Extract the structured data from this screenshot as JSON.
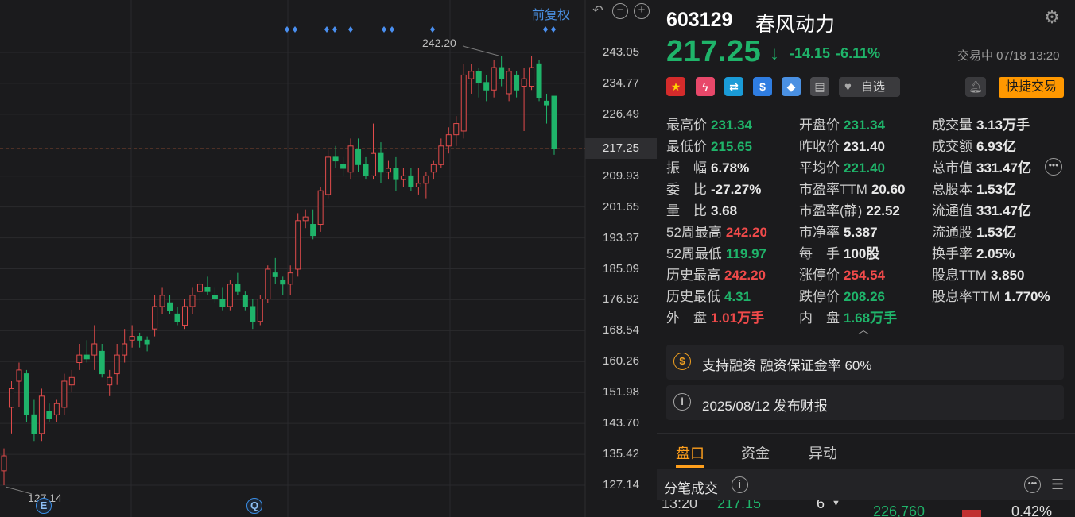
{
  "chart": {
    "adj_label": "前复权",
    "icons": [
      "undo-icon",
      "zoom-out-icon",
      "zoom-in-icon"
    ],
    "price_axis": [
      "243.05",
      "234.77",
      "226.49",
      "217.25",
      "209.93",
      "201.65",
      "193.37",
      "185.09",
      "176.82",
      "168.54",
      "160.26",
      "151.98",
      "143.70",
      "135.42",
      "127.14"
    ],
    "current_price_tag": "217.25",
    "high_label": "242.20",
    "low_label": "127.14",
    "event_badges": [
      "E",
      "Q"
    ]
  },
  "chart_data": {
    "type": "candlestick",
    "ylim": [
      127.14,
      243.05
    ],
    "current_price": 217.25,
    "period_high": 242.2,
    "period_low": 127.14,
    "candles": [
      {
        "o": 131,
        "h": 137,
        "l": 127.14,
        "c": 135
      },
      {
        "o": 148,
        "h": 155,
        "l": 141,
        "c": 153
      },
      {
        "o": 155,
        "h": 160,
        "l": 148,
        "c": 158
      },
      {
        "o": 157,
        "h": 158,
        "l": 144,
        "c": 146
      },
      {
        "o": 146,
        "h": 150,
        "l": 139,
        "c": 141
      },
      {
        "o": 141,
        "h": 153,
        "l": 139,
        "c": 151
      },
      {
        "o": 147,
        "h": 149,
        "l": 144,
        "c": 145
      },
      {
        "o": 146,
        "h": 150,
        "l": 144,
        "c": 149
      },
      {
        "o": 148,
        "h": 157,
        "l": 146,
        "c": 155
      },
      {
        "o": 154,
        "h": 158,
        "l": 152,
        "c": 156
      },
      {
        "o": 160,
        "h": 165,
        "l": 158,
        "c": 162
      },
      {
        "o": 162,
        "h": 166,
        "l": 160,
        "c": 161
      },
      {
        "o": 162,
        "h": 170,
        "l": 158,
        "c": 165
      },
      {
        "o": 163,
        "h": 165,
        "l": 156,
        "c": 157
      },
      {
        "o": 154,
        "h": 158,
        "l": 151,
        "c": 156
      },
      {
        "o": 157,
        "h": 165,
        "l": 154,
        "c": 162
      },
      {
        "o": 162,
        "h": 169,
        "l": 160,
        "c": 165
      },
      {
        "o": 166,
        "h": 170,
        "l": 164,
        "c": 167
      },
      {
        "o": 167,
        "h": 168,
        "l": 164,
        "c": 166
      },
      {
        "o": 166,
        "h": 167,
        "l": 163,
        "c": 165
      },
      {
        "o": 169,
        "h": 178,
        "l": 167,
        "c": 175
      },
      {
        "o": 175,
        "h": 180,
        "l": 173,
        "c": 178
      },
      {
        "o": 176,
        "h": 178,
        "l": 173,
        "c": 174
      },
      {
        "o": 173,
        "h": 175,
        "l": 170,
        "c": 171
      },
      {
        "o": 170,
        "h": 177,
        "l": 169,
        "c": 175
      },
      {
        "o": 175,
        "h": 180,
        "l": 173,
        "c": 178
      },
      {
        "o": 179,
        "h": 182,
        "l": 176,
        "c": 181
      },
      {
        "o": 180,
        "h": 183,
        "l": 178,
        "c": 179
      },
      {
        "o": 178,
        "h": 180,
        "l": 176,
        "c": 177
      },
      {
        "o": 177,
        "h": 180,
        "l": 174,
        "c": 175
      },
      {
        "o": 175,
        "h": 182,
        "l": 174,
        "c": 181
      },
      {
        "o": 181,
        "h": 184,
        "l": 178,
        "c": 179
      },
      {
        "o": 178,
        "h": 179,
        "l": 174,
        "c": 175
      },
      {
        "o": 175,
        "h": 177,
        "l": 169,
        "c": 171
      },
      {
        "o": 171,
        "h": 178,
        "l": 170,
        "c": 177
      },
      {
        "o": 177,
        "h": 186,
        "l": 176,
        "c": 185
      },
      {
        "o": 184,
        "h": 188,
        "l": 181,
        "c": 183
      },
      {
        "o": 182,
        "h": 183,
        "l": 178,
        "c": 181
      },
      {
        "o": 181,
        "h": 186,
        "l": 178,
        "c": 184
      },
      {
        "o": 185,
        "h": 200,
        "l": 183,
        "c": 198
      },
      {
        "o": 198,
        "h": 201,
        "l": 196,
        "c": 199
      },
      {
        "o": 197,
        "h": 201,
        "l": 193,
        "c": 194
      },
      {
        "o": 197,
        "h": 207,
        "l": 195,
        "c": 206
      },
      {
        "o": 205,
        "h": 217,
        "l": 204,
        "c": 215
      },
      {
        "o": 215,
        "h": 218,
        "l": 212,
        "c": 214
      },
      {
        "o": 213,
        "h": 215,
        "l": 210,
        "c": 212
      },
      {
        "o": 211,
        "h": 220,
        "l": 209,
        "c": 218
      },
      {
        "o": 217,
        "h": 220,
        "l": 211,
        "c": 213
      },
      {
        "o": 213,
        "h": 215,
        "l": 209,
        "c": 210
      },
      {
        "o": 210,
        "h": 224,
        "l": 209,
        "c": 216
      },
      {
        "o": 216,
        "h": 219,
        "l": 208,
        "c": 211
      },
      {
        "o": 211,
        "h": 214,
        "l": 209,
        "c": 212
      },
      {
        "o": 212,
        "h": 215,
        "l": 206,
        "c": 209
      },
      {
        "o": 209,
        "h": 212,
        "l": 207,
        "c": 210
      },
      {
        "o": 210,
        "h": 212,
        "l": 206,
        "c": 207
      },
      {
        "o": 207,
        "h": 212,
        "l": 205,
        "c": 208
      },
      {
        "o": 208,
        "h": 211,
        "l": 204,
        "c": 210
      },
      {
        "o": 211,
        "h": 214,
        "l": 209,
        "c": 213
      },
      {
        "o": 213,
        "h": 220,
        "l": 212,
        "c": 218
      },
      {
        "o": 218,
        "h": 223,
        "l": 216,
        "c": 221
      },
      {
        "o": 221,
        "h": 226,
        "l": 218,
        "c": 224
      },
      {
        "o": 222,
        "h": 240,
        "l": 220,
        "c": 237
      },
      {
        "o": 236,
        "h": 240,
        "l": 232,
        "c": 238
      },
      {
        "o": 238,
        "h": 239,
        "l": 231,
        "c": 235
      },
      {
        "o": 235,
        "h": 237,
        "l": 230,
        "c": 233
      },
      {
        "o": 233,
        "h": 241,
        "l": 231,
        "c": 239
      },
      {
        "o": 239,
        "h": 242.2,
        "l": 234,
        "c": 236
      },
      {
        "o": 232,
        "h": 239,
        "l": 230,
        "c": 238
      },
      {
        "o": 237,
        "h": 238,
        "l": 231,
        "c": 233
      },
      {
        "o": 234,
        "h": 239,
        "l": 222,
        "c": 236
      },
      {
        "o": 234,
        "h": 242,
        "l": 233,
        "c": 239
      },
      {
        "o": 240,
        "h": 241,
        "l": 230,
        "c": 231
      },
      {
        "o": 230,
        "h": 232,
        "l": 224,
        "c": 229
      },
      {
        "o": 231.34,
        "h": 231.34,
        "l": 215.65,
        "c": 217.25
      }
    ]
  },
  "quote": {
    "code": "603129",
    "name": "春风动力",
    "price": "217.25",
    "change": "-14.15",
    "change_pct": "-6.11%",
    "status": "交易中 07/18 13:20"
  },
  "actions": {
    "watch": "自选",
    "quick_trade": "快捷交易"
  },
  "stats": [
    [
      {
        "label": "最高价",
        "value": "231.34",
        "tone": "down"
      },
      {
        "label": "开盘价",
        "value": "231.34",
        "tone": "down"
      },
      {
        "label": "成交量",
        "value": "3.13万手",
        "tone": "neutral"
      }
    ],
    [
      {
        "label": "最低价",
        "value": "215.65",
        "tone": "down"
      },
      {
        "label": "昨收价",
        "value": "231.40",
        "tone": "plain"
      },
      {
        "label": "成交额",
        "value": "6.93亿",
        "tone": "neutral"
      }
    ],
    [
      {
        "label": "振　幅",
        "value": "6.78%",
        "tone": "neutral"
      },
      {
        "label": "平均价",
        "value": "221.40",
        "tone": "down"
      },
      {
        "label": "总市值",
        "value": "331.47亿",
        "tone": "neutral"
      }
    ],
    [
      {
        "label": "委　比",
        "value": "-27.27%",
        "tone": "neutral"
      },
      {
        "label": "市盈率TTM",
        "value": "20.60",
        "tone": "neutral"
      },
      {
        "label": "总股本",
        "value": "1.53亿",
        "tone": "neutral"
      }
    ],
    [
      {
        "label": "量　比",
        "value": "3.68",
        "tone": "neutral"
      },
      {
        "label": "市盈率(静)",
        "value": "22.52",
        "tone": "neutral"
      },
      {
        "label": "流通值",
        "value": "331.47亿",
        "tone": "neutral"
      }
    ],
    [
      {
        "label": "52周最高",
        "value": "242.20",
        "tone": "up"
      },
      {
        "label": "市净率",
        "value": "5.387",
        "tone": "neutral"
      },
      {
        "label": "流通股",
        "value": "1.53亿",
        "tone": "neutral"
      }
    ],
    [
      {
        "label": "52周最低",
        "value": "119.97",
        "tone": "down"
      },
      {
        "label": "每　手",
        "value": "100股",
        "tone": "neutral"
      },
      {
        "label": "换手率",
        "value": "2.05%",
        "tone": "neutral"
      }
    ],
    [
      {
        "label": "历史最高",
        "value": "242.20",
        "tone": "up"
      },
      {
        "label": "涨停价",
        "value": "254.54",
        "tone": "up"
      },
      {
        "label": "股息TTM",
        "value": "3.850",
        "tone": "neutral"
      }
    ],
    [
      {
        "label": "历史最低",
        "value": "4.31",
        "tone": "down"
      },
      {
        "label": "跌停价",
        "value": "208.26",
        "tone": "down"
      },
      {
        "label": "股息率TTM",
        "value": "1.770%",
        "tone": "neutral"
      }
    ],
    [
      {
        "label": "外　盘",
        "value": "1.01万手",
        "tone": "up"
      },
      {
        "label": "内　盘",
        "value": "1.68万手",
        "tone": "down"
      }
    ]
  ],
  "cards": {
    "margin": "支持融资 融资保证金率 60%",
    "report": "2025/08/12  发布财报"
  },
  "tabs": [
    "盘口",
    "资金",
    "异动"
  ],
  "ticks": {
    "title": "分笔成交",
    "row": {
      "time": "13:20",
      "price": "217.15",
      "vol": "6",
      "amount": "226,760",
      "pct": "0.42%"
    }
  },
  "colors": {
    "up": "#f04a4a",
    "down": "#1fb46a",
    "accent": "#ff9800",
    "link": "#4a90e2"
  }
}
